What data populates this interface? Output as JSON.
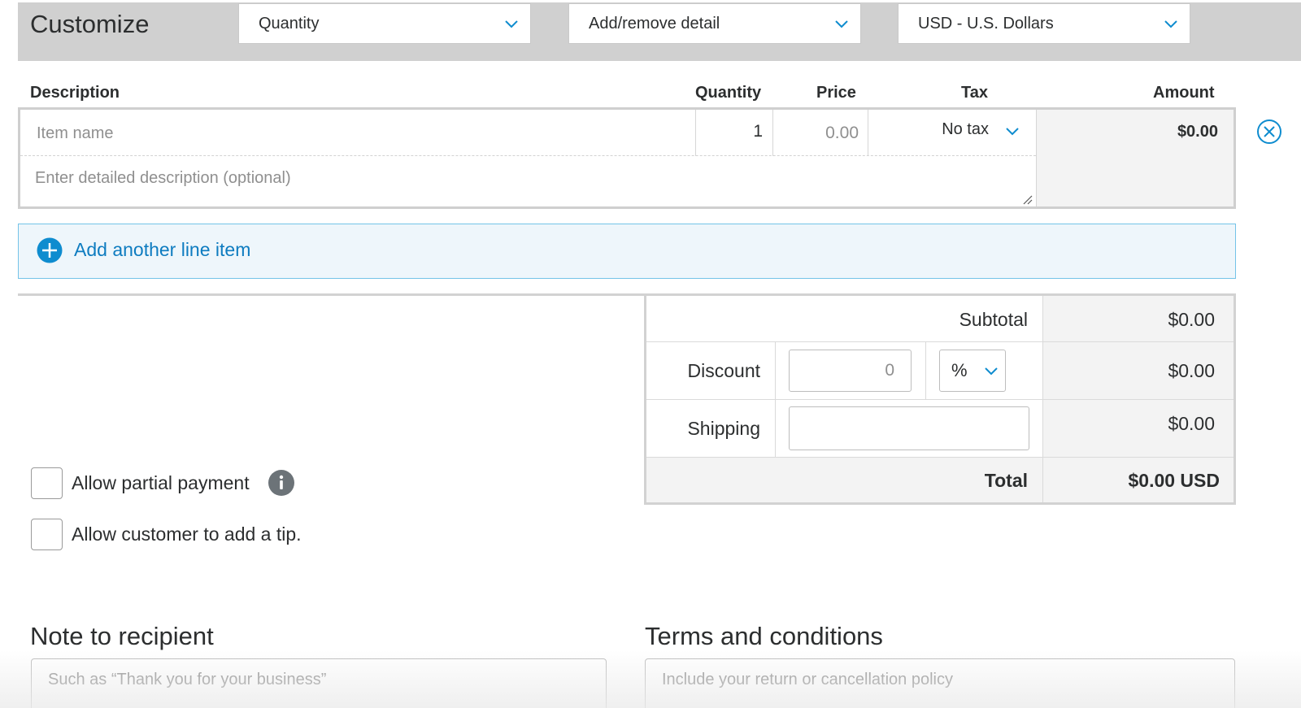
{
  "customize": {
    "title": "Customize",
    "quantity_select": "Quantity",
    "detail_select": "Add/remove detail",
    "currency_select": "USD - U.S. Dollars"
  },
  "columns": {
    "description": "Description",
    "quantity": "Quantity",
    "price": "Price",
    "tax": "Tax",
    "amount": "Amount"
  },
  "item": {
    "name_placeholder": "Item name",
    "quantity": "1",
    "price_placeholder": "0.00",
    "tax": "No tax",
    "description_placeholder": "Enter detailed description (optional)",
    "amount": "$0.00"
  },
  "add_line_label": "Add another line item",
  "totals": {
    "subtotal_label": "Subtotal",
    "subtotal_value": "$0.00",
    "discount_label": "Discount",
    "discount_placeholder": "0",
    "discount_type": "%",
    "discount_value": "$0.00",
    "shipping_label": "Shipping",
    "shipping_value": "$0.00",
    "total_label": "Total",
    "total_value": "$0.00 USD"
  },
  "options": {
    "partial_payment": "Allow partial payment",
    "tip": "Allow customer to add a tip."
  },
  "note": {
    "title": "Note to recipient",
    "placeholder": "Such as “Thank you for your business”"
  },
  "terms": {
    "title": "Terms and conditions",
    "placeholder": "Include your return or cancellation policy"
  },
  "colors": {
    "accent": "#0e8ccf",
    "add_line_bg": "#eef6fb",
    "customize_bg": "#d0d0d0",
    "info_icon": "#6c7378"
  }
}
